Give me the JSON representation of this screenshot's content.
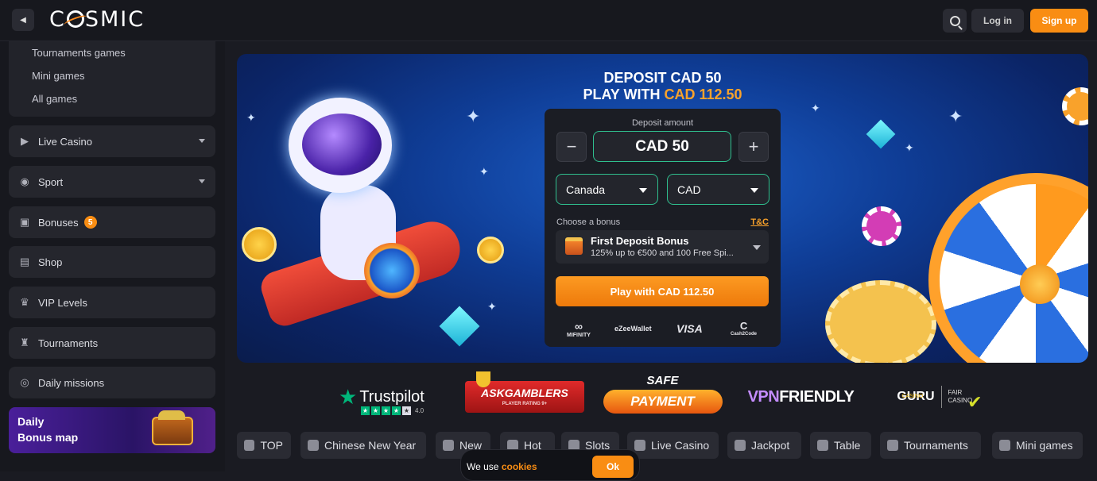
{
  "brand": {
    "logo_text": "CSMIC",
    "logo_prefix": "C",
    "logo_suffix": "SMIC",
    "accent_color": "#f98d13"
  },
  "header": {
    "login_label": "Log in",
    "signup_label": "Sign up"
  },
  "sidebar": {
    "sub_items": [
      "Tournaments games",
      "Mini games",
      "All games"
    ],
    "items": [
      {
        "label": "Live Casino",
        "icon": "play-square-icon",
        "has_caret": true
      },
      {
        "label": "Sport",
        "icon": "basketball-icon",
        "has_caret": true
      },
      {
        "label": "Bonuses",
        "icon": "gift-icon",
        "badge": "5"
      },
      {
        "label": "Shop",
        "icon": "basket-icon"
      },
      {
        "label": "VIP Levels",
        "icon": "crown-icon"
      },
      {
        "label": "Tournaments",
        "icon": "trophy-icon"
      },
      {
        "label": "Daily missions",
        "icon": "medal-icon"
      }
    ],
    "bonus_map": {
      "line1": "Daily",
      "line2": "Bonus map"
    }
  },
  "banner": {
    "title_line1": "DEPOSIT CAD 50",
    "title_line2_prefix": "PLAY WITH ",
    "title_line2_highlight": "CAD 112.50",
    "deposit": {
      "label": "Deposit amount",
      "amount": "CAD 50",
      "minus": "−",
      "plus": "+",
      "country": "Canada",
      "currency": "CAD",
      "choose_bonus_label": "Choose a bonus",
      "tnc_label": "T&C",
      "bonus_name": "First Deposit Bonus",
      "bonus_desc": "125% up to €500 and 100 Free Spi...",
      "play_button": "Play with CAD 112.50",
      "payment_methods": [
        "MIFINITY",
        "eZeeWallet",
        "VISA",
        "Cash2Code"
      ]
    }
  },
  "trust": {
    "trustpilot": {
      "name": "Trustpilot",
      "score": "4.0"
    },
    "askgamblers": {
      "name": "ASKGAMBLERS",
      "sub": "PLAYER RATING 9+"
    },
    "safe_payment": {
      "line1": "SAFE",
      "line2": "PAYMENT"
    },
    "vpn": {
      "prefix": "VPN",
      "suffix": "FRIENDLY"
    },
    "guru": {
      "top": "CASINO",
      "name": "GURU",
      "fair1": "FAIR",
      "fair2": "CASINO"
    }
  },
  "categories": [
    {
      "label": "TOP",
      "icon": "star-icon"
    },
    {
      "label": "Chinese New Year",
      "icon": "dragon-icon"
    },
    {
      "label": "New",
      "icon": "bell-icon"
    },
    {
      "label": "Hot",
      "icon": "flame-icon"
    },
    {
      "label": "Slots",
      "icon": "slot-icon"
    },
    {
      "label": "Live Casino",
      "icon": "play-square-icon"
    },
    {
      "label": "Jackpot",
      "icon": "jackpot-icon"
    },
    {
      "label": "Table",
      "icon": "chip-icon"
    },
    {
      "label": "Tournaments",
      "icon": "trophy-icon"
    },
    {
      "label": "Mini games",
      "icon": "dice-icon"
    }
  ],
  "cookie": {
    "text": "We use ",
    "link": "cookies",
    "ok": "Ok"
  }
}
